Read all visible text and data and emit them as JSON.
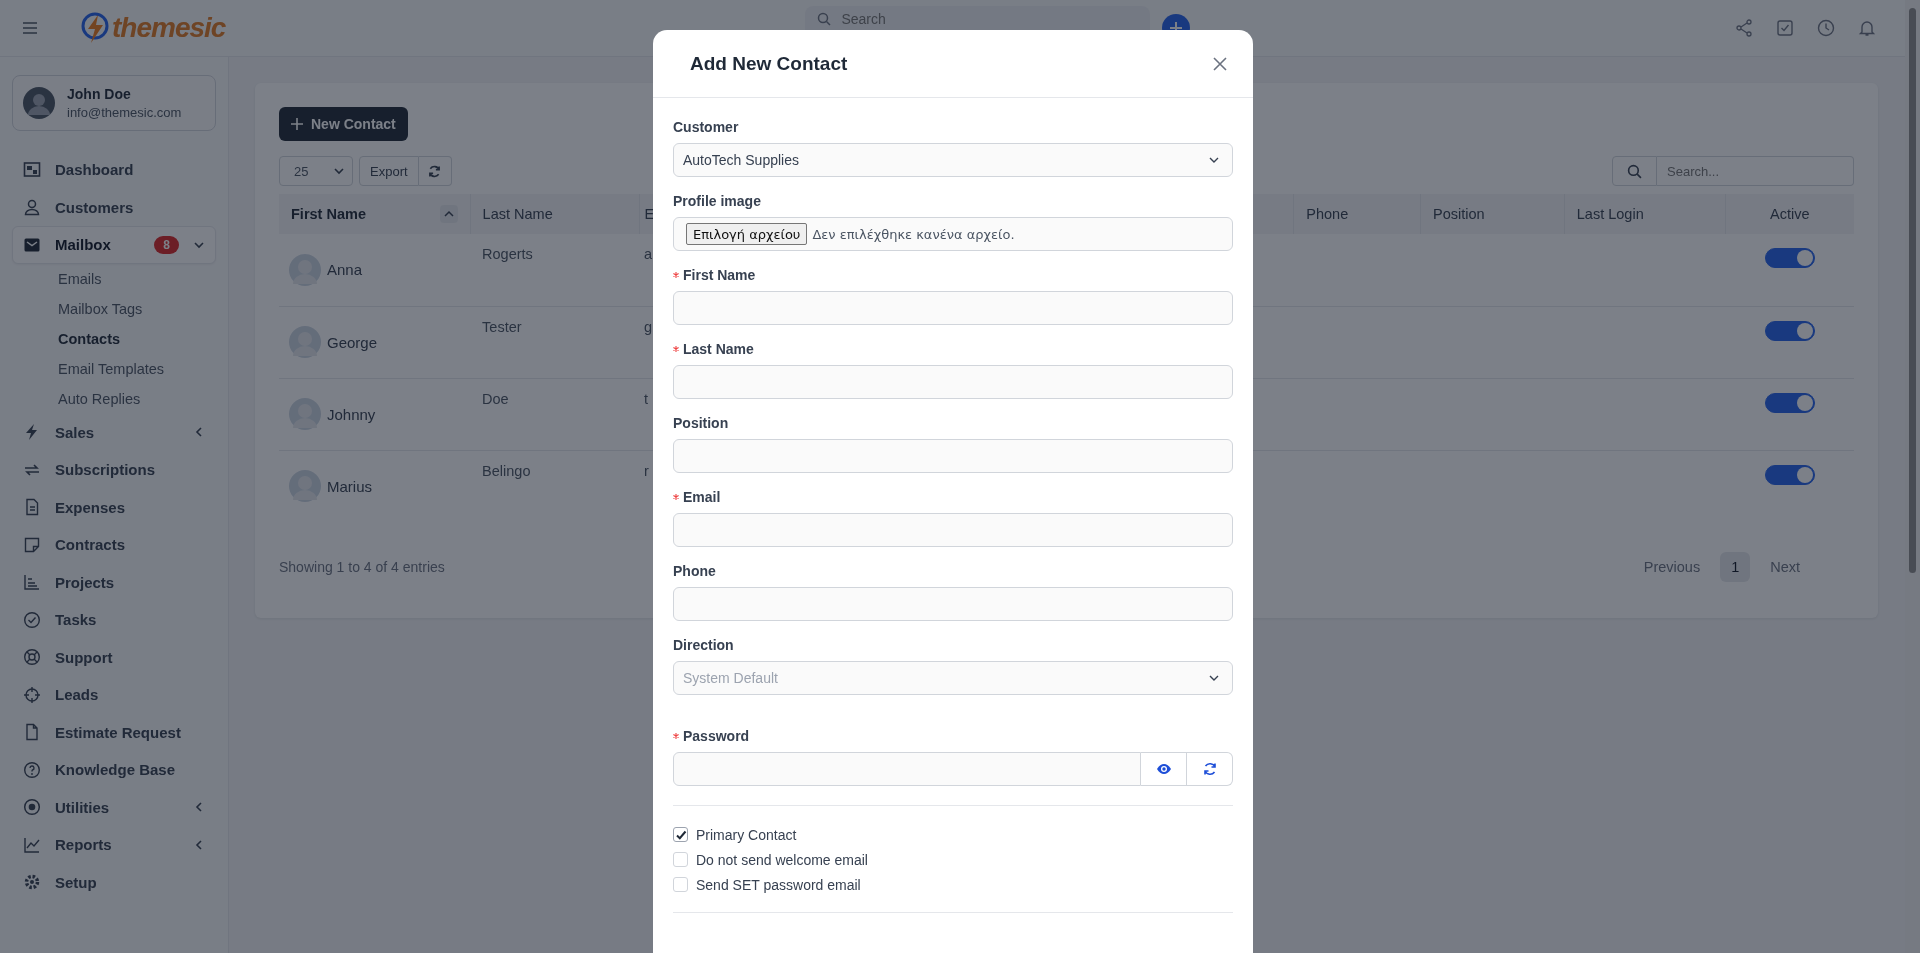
{
  "header": {
    "logo": "themesic",
    "search": {
      "placeholder": "Search"
    }
  },
  "user": {
    "name": "John Doe",
    "email": "info@themesic.com"
  },
  "sidebar": {
    "items": [
      {
        "label": "Dashboard",
        "kind": "link",
        "selected": false
      },
      {
        "label": "Customers",
        "kind": "link",
        "selected": false
      },
      {
        "label": "Mailbox",
        "kind": "group",
        "expanded": true,
        "selected": true,
        "badge": "8",
        "children": [
          {
            "label": "Emails",
            "selected": false
          },
          {
            "label": "Mailbox Tags",
            "selected": false
          },
          {
            "label": "Contacts",
            "selected": true
          },
          {
            "label": "Email Templates",
            "selected": false
          },
          {
            "label": "Auto Replies",
            "selected": false
          }
        ]
      },
      {
        "label": "Sales",
        "kind": "group",
        "expanded": false,
        "selected": false
      },
      {
        "label": "Subscriptions",
        "kind": "link",
        "selected": false
      },
      {
        "label": "Expenses",
        "kind": "link",
        "selected": false
      },
      {
        "label": "Contracts",
        "kind": "link",
        "selected": false
      },
      {
        "label": "Projects",
        "kind": "link",
        "selected": false
      },
      {
        "label": "Tasks",
        "kind": "link",
        "selected": false
      },
      {
        "label": "Support",
        "kind": "link",
        "selected": false
      },
      {
        "label": "Leads",
        "kind": "link",
        "selected": false
      },
      {
        "label": "Estimate Request",
        "kind": "link",
        "selected": false
      },
      {
        "label": "Knowledge Base",
        "kind": "link",
        "selected": false
      },
      {
        "label": "Utilities",
        "kind": "group",
        "expanded": false,
        "selected": false
      },
      {
        "label": "Reports",
        "kind": "group",
        "expanded": false,
        "selected": false
      },
      {
        "label": "Setup",
        "kind": "link",
        "selected": false
      }
    ]
  },
  "toolbar": {
    "new_button": "New Contact",
    "page_size": "25",
    "export": "Export",
    "search": {
      "placeholder": "Search..."
    }
  },
  "table": {
    "columns": [
      "First Name",
      "Last Name",
      "E",
      "Phone",
      "Position",
      "Last Login",
      "Active"
    ],
    "rows": [
      {
        "first_name": "Anna",
        "last_name": "Rogerts",
        "column_3": "a",
        "active": true
      },
      {
        "first_name": "George",
        "last_name": "Tester",
        "column_3": "g",
        "active": true
      },
      {
        "first_name": "Johnny",
        "last_name": "Doe",
        "column_3": "t",
        "active": true
      },
      {
        "first_name": "Marius",
        "last_name": "Belingo",
        "column_3": "r",
        "active": true
      }
    ]
  },
  "footer": {
    "info": "Showing 1 to 4 of 4 entries",
    "pagination": [
      {
        "label": "Previous",
        "kind": "prev",
        "selected": false
      },
      {
        "label": "1",
        "kind": "page",
        "selected": true
      },
      {
        "label": "Next",
        "kind": "next",
        "selected": false
      }
    ]
  },
  "modal": {
    "title": "Add New Contact",
    "fields": [
      {
        "kind": "select",
        "label": "Customer",
        "required": false,
        "value": "AutoTech Supplies"
      },
      {
        "kind": "file",
        "label": "Profile image",
        "required": false,
        "button": "Επιλογή αρχείου",
        "status": "Δεν επιλέχθηκε κανένα αρχείο."
      },
      {
        "kind": "text",
        "label": "First Name",
        "required": true
      },
      {
        "kind": "text",
        "label": "Last Name",
        "required": true
      },
      {
        "kind": "text",
        "label": "Position",
        "required": false
      },
      {
        "kind": "text",
        "label": "Email",
        "required": true
      },
      {
        "kind": "text",
        "label": "Phone",
        "required": false
      },
      {
        "kind": "select",
        "label": "Direction",
        "required": false,
        "placeholder": "System Default"
      },
      {
        "kind": "password",
        "label": "Password",
        "required": true
      }
    ],
    "checkboxes": [
      {
        "label": "Primary Contact",
        "checked": true
      },
      {
        "label": "Do not send welcome email",
        "checked": false
      },
      {
        "label": "Send SET password email",
        "checked": false
      }
    ]
  }
}
